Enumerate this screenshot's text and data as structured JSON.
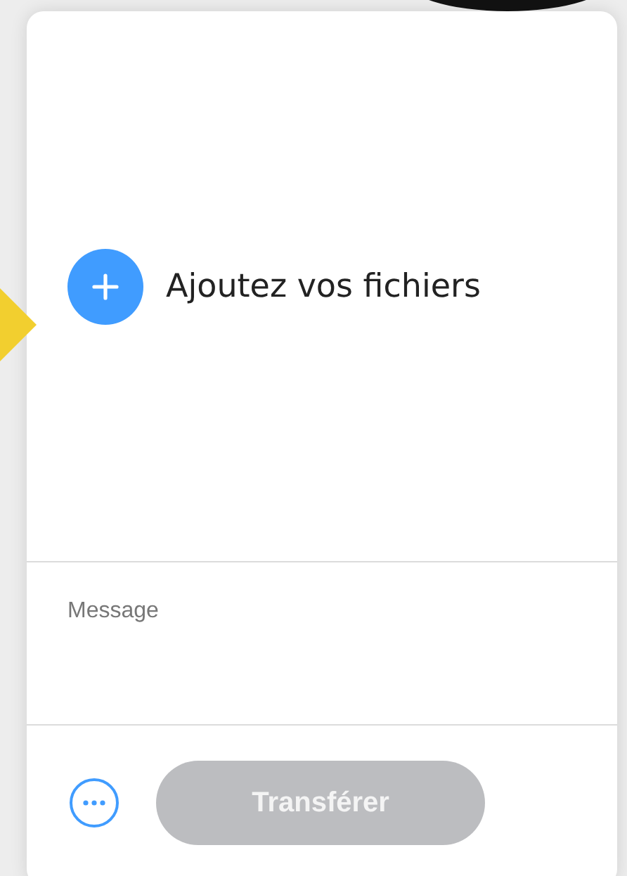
{
  "upload": {
    "label": "Ajoutez vos fichiers"
  },
  "message": {
    "placeholder": "Message"
  },
  "footer": {
    "transfer_button": {
      "label": "Transférer",
      "disabled": true
    }
  }
}
